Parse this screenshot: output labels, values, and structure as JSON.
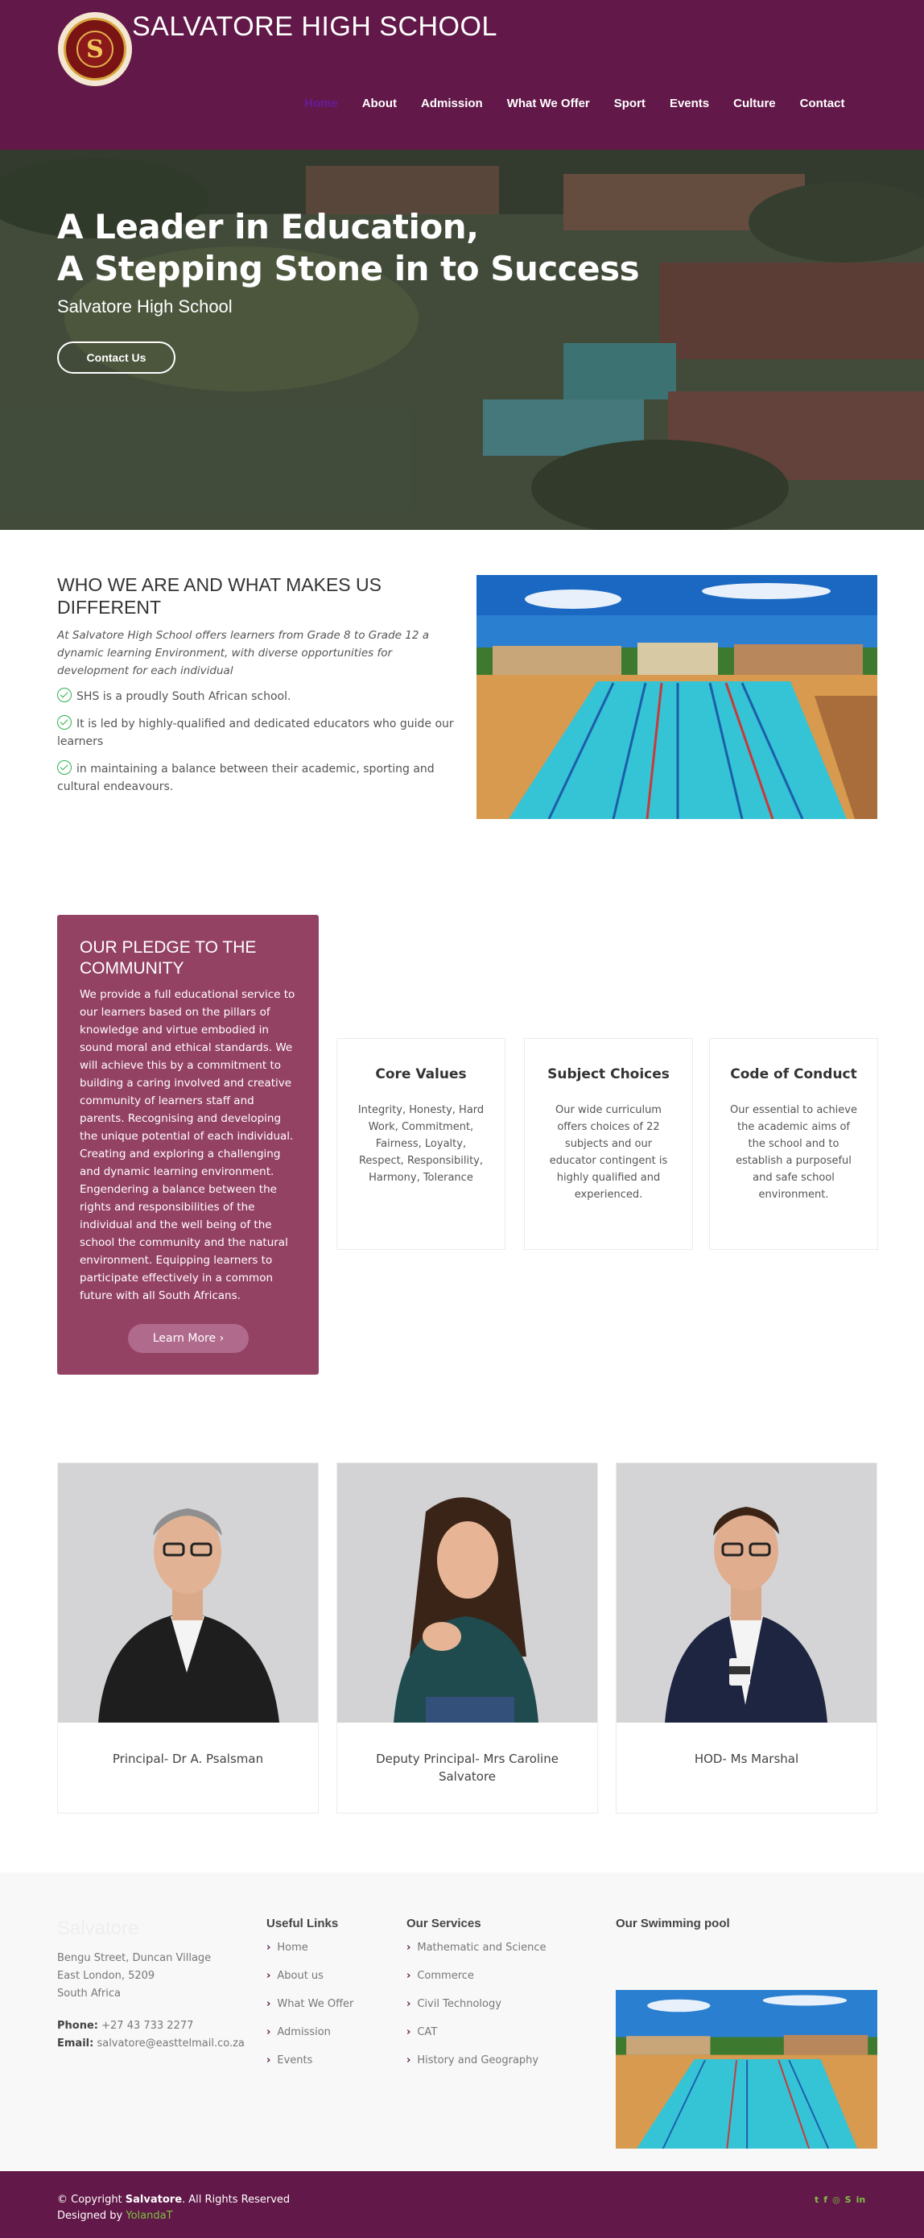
{
  "header": {
    "site_title": "SALVATORE HIGH SCHOOL",
    "nav": [
      "Home",
      "About",
      "Admission",
      "What We Offer",
      "Sport",
      "Events",
      "Culture",
      "Contact"
    ],
    "active_nav": "Home"
  },
  "hero": {
    "title_line1": "A Leader in Education,",
    "title_line2": "A Stepping Stone in to Success",
    "subtitle": "Salvatore High School",
    "cta_label": "Contact Us"
  },
  "who": {
    "heading": "WHO WE ARE AND WHAT MAKES US DIFFERENT",
    "intro": "At Salvatore High School offers learners from Grade 8 to Grade 12 a dynamic learning Environment, with diverse opportunities for development for each individual",
    "points": [
      "SHS is a proudly South African school.",
      "It is led by highly-qualified and dedicated educators who guide our learners",
      "in maintaining a balance between their academic, sporting and cultural endeavours."
    ]
  },
  "pledge": {
    "heading": "OUR PLEDGE TO THE COMMUNITY",
    "body": "We provide a full educational service to our learners based on the pillars of knowledge and virtue embodied in sound moral and ethical standards. We will achieve this by a commitment to building a caring involved and creative community of learners staff and parents. Recognising and developing the unique potential of each individual. Creating and exploring a challenging and dynamic learning environment. Engendering a balance between the rights and responsibilities of the individual and the well being of the school the community and the natural environment. Equipping learners to participate effectively in a common future with all South Africans.",
    "button_label": "Learn More ›"
  },
  "cards": [
    {
      "title": "Core Values",
      "text": "Integrity, Honesty, Hard Work, Commitment, Fairness, Loyalty, Respect, Responsibility, Harmony, Tolerance"
    },
    {
      "title": "Subject Choices",
      "text": "Our wide curriculum offers choices of 22 subjects and our educator contingent is highly qualified and experienced."
    },
    {
      "title": "Code of Conduct",
      "text": "Our essential to achieve the academic aims of the school and to establish a purposeful and safe school environment."
    }
  ],
  "staff": [
    {
      "name": "Principal- Dr A. Psalsman"
    },
    {
      "name": "Deputy Principal- Mrs Caroline Salvatore"
    },
    {
      "name": "HOD- Ms Marshal"
    }
  ],
  "footer": {
    "brand": "Salvatore",
    "address": [
      "Bengu Street, Duncan Village",
      "East London, 5209",
      "South Africa"
    ],
    "phone_label": "Phone:",
    "phone": "+27 43 733 2277",
    "email_label": "Email:",
    "email": "salvatore@easttelmail.co.za",
    "useful_links_heading": "Useful Links",
    "useful_links": [
      "Home",
      "About us",
      "What We Offer",
      "Admission",
      "Events"
    ],
    "services_heading": "Our Services",
    "services": [
      "Mathematic and Science",
      "Commerce",
      "Civil Technology",
      "CAT",
      "History and Geography"
    ],
    "pool_heading": "Our Swimming pool"
  },
  "bottom": {
    "copyright_prefix": "© Copyright ",
    "copyright_brand": "Salvatore",
    "copyright_suffix": ". All Rights Reserved",
    "designed_prefix": "Designed by ",
    "designer": "YolandaT",
    "social_icons": [
      "twitter-icon",
      "facebook-icon",
      "instagram-icon",
      "skype-icon",
      "linkedin-icon"
    ]
  },
  "colors": {
    "brand": "#621848",
    "pledge_bg": "#944264",
    "accent_green": "#7dc242",
    "check_green": "#2bb24c",
    "active_nav": "#6a1a9a"
  }
}
